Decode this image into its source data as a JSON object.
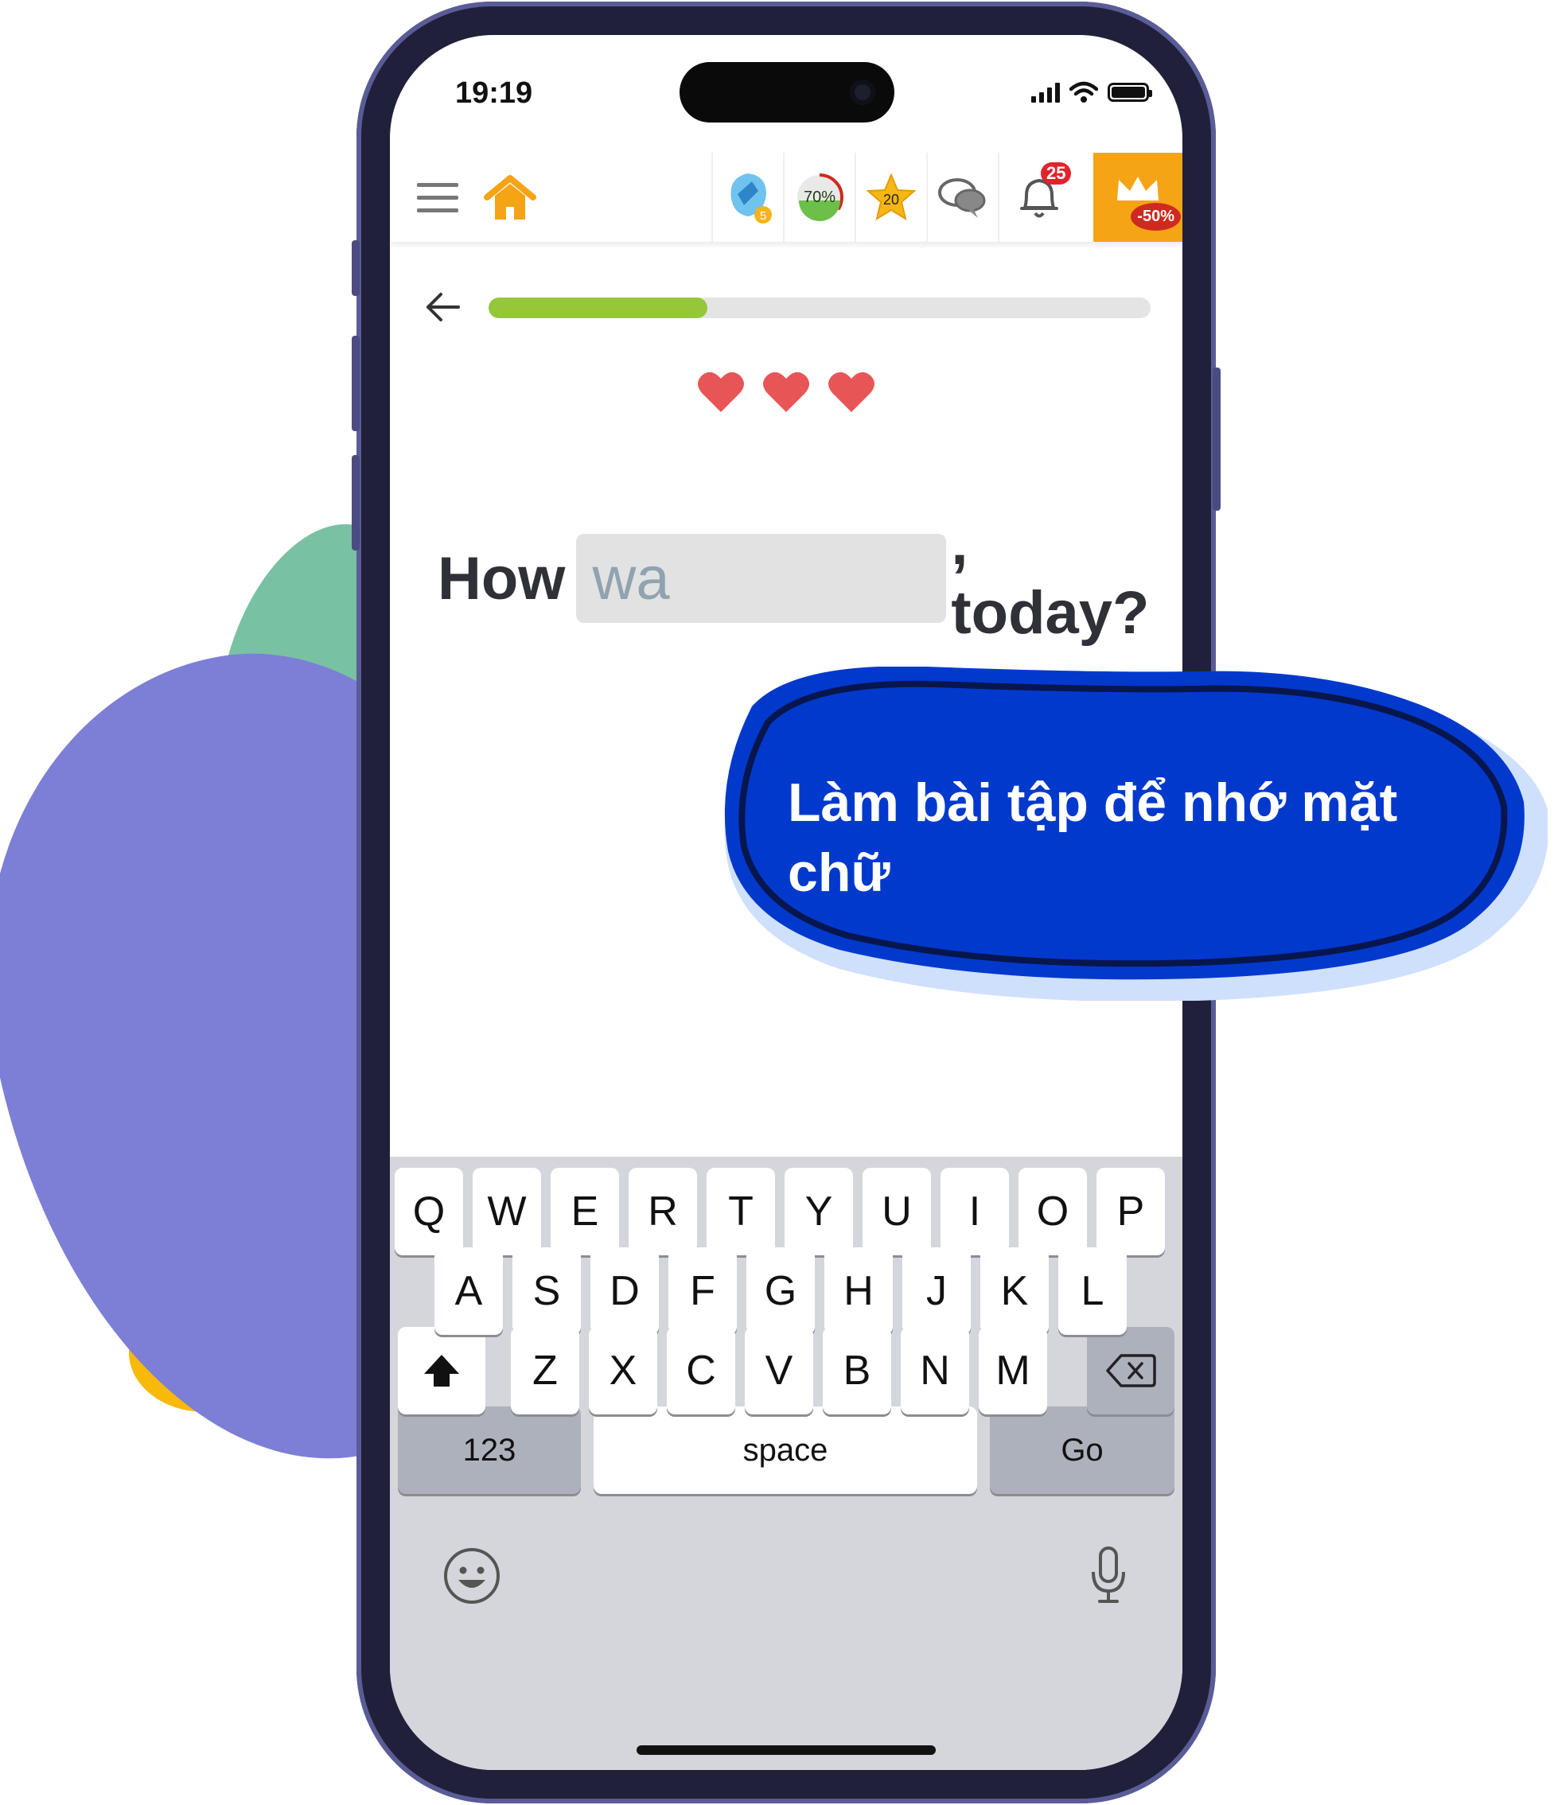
{
  "status_bar": {
    "time": "19:19"
  },
  "app_bar": {
    "gems_count": "5",
    "progress_percent": "70%",
    "stars": "20",
    "notifications": "25",
    "promo": "-50%"
  },
  "lesson": {
    "progress": 0.33,
    "lives": 3,
    "sentence_before": "How",
    "typed_answer": "wa",
    "sentence_after": ", today?"
  },
  "callout": {
    "text": "Làm bài tập để nhớ mặt chữ"
  },
  "keyboard": {
    "row1": [
      "Q",
      "W",
      "E",
      "R",
      "T",
      "Y",
      "U",
      "I",
      "O",
      "P"
    ],
    "row2": [
      "A",
      "S",
      "D",
      "F",
      "G",
      "H",
      "J",
      "K",
      "L"
    ],
    "row3": [
      "Z",
      "X",
      "C",
      "V",
      "B",
      "N",
      "M"
    ],
    "numbers_key": "123",
    "space_key": "space",
    "go_key": "Go"
  },
  "colors": {
    "accent_green": "#94c83a",
    "heart_red": "#e85556",
    "callout_blue": "#0239cd",
    "promo_orange": "#f5a416"
  },
  "icons": [
    "menu-icon",
    "home-icon",
    "crystal-icon",
    "progress-ring-icon",
    "star-icon",
    "chat-icon",
    "bell-icon",
    "crown-icon",
    "back-arrow-icon",
    "heart-icon",
    "shift-icon",
    "backspace-icon",
    "emoji-icon",
    "microphone-icon"
  ]
}
